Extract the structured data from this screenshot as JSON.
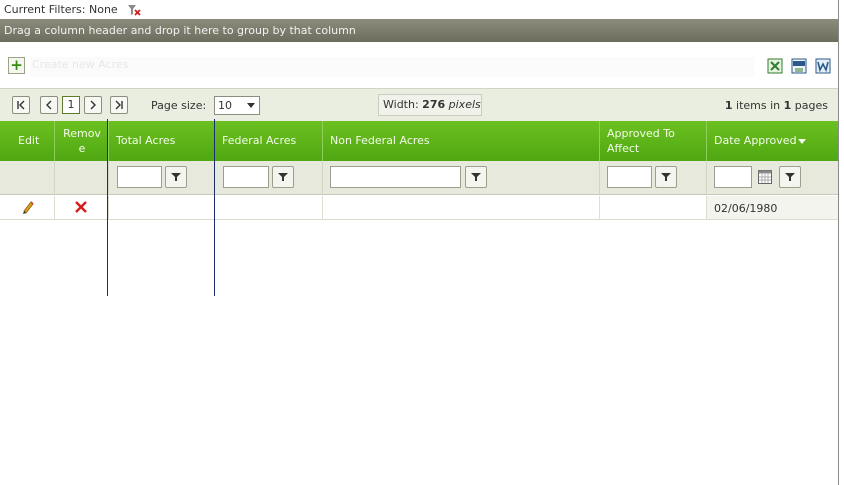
{
  "filters": {
    "label": "Current Filters: None"
  },
  "group_panel": {
    "text": "Drag a column header and drop it here to group by that column"
  },
  "command": {
    "add_label": "Create new Acres"
  },
  "pager": {
    "current_page": "1",
    "page_size_label": "Page size:",
    "page_size_value": "10",
    "width_label": "Width:",
    "width_value": "276",
    "width_unit": "pixels",
    "items_count": "1",
    "items_text": " items in ",
    "pages_count": "1",
    "pages_text": " pages"
  },
  "columns": [
    {
      "key": "edit",
      "label": "Edit"
    },
    {
      "key": "remove",
      "label": "Remov\ne"
    },
    {
      "key": "total_acres",
      "label": "Total Acres"
    },
    {
      "key": "federal_acres",
      "label": "Federal Acres"
    },
    {
      "key": "non_federal_acres",
      "label": "Non Federal Acres"
    },
    {
      "key": "approved_to_affect",
      "label": "Approved To\nAffect"
    },
    {
      "key": "date_approved",
      "label": "Date Approved"
    }
  ],
  "rows": [
    {
      "total_acres": "",
      "federal_acres": "",
      "non_federal_acres": "",
      "approved_to_affect": "",
      "date_approved": "02/06/1980"
    }
  ],
  "colors": {
    "header_green": "#5cb318",
    "group_panel": "#7a7a6a",
    "pager_bg": "#eaeee0",
    "remove_red": "#d61c1c",
    "resize_line": "#1c2e73"
  },
  "icons": {
    "clear_filter": "clear-filter-icon",
    "add": "plus-icon",
    "export": [
      "excel-export-icon",
      "csv-export-icon",
      "word-export-icon"
    ],
    "pager": [
      "first-page-icon",
      "prev-page-icon",
      "next-page-icon",
      "last-page-icon"
    ],
    "filter": "filter-funnel-icon",
    "calendar": "calendar-icon",
    "edit": "pencil-icon",
    "remove": "red-x-icon",
    "sort": "sort-desc-icon"
  }
}
